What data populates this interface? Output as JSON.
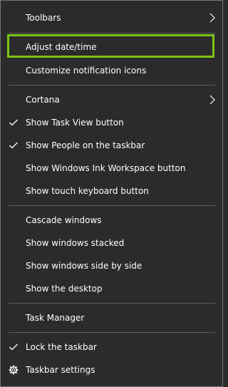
{
  "menu": {
    "items": [
      {
        "label": "Toolbars",
        "checked": false,
        "submenu": true
      },
      {
        "label": "Adjust date/time",
        "checked": false,
        "submenu": false,
        "highlighted": true
      },
      {
        "label": "Customize notification icons",
        "checked": false,
        "submenu": false
      },
      {
        "label": "Cortana",
        "checked": false,
        "submenu": true
      },
      {
        "label": "Show Task View button",
        "checked": true,
        "submenu": false
      },
      {
        "label": "Show People on the taskbar",
        "checked": true,
        "submenu": false
      },
      {
        "label": "Show Windows Ink Workspace button",
        "checked": false,
        "submenu": false
      },
      {
        "label": "Show touch keyboard button",
        "checked": false,
        "submenu": false
      },
      {
        "label": "Cascade windows",
        "checked": false,
        "submenu": false
      },
      {
        "label": "Show windows stacked",
        "checked": false,
        "submenu": false
      },
      {
        "label": "Show windows side by side",
        "checked": false,
        "submenu": false
      },
      {
        "label": "Show the desktop",
        "checked": false,
        "submenu": false
      },
      {
        "label": "Task Manager",
        "checked": false,
        "submenu": false
      },
      {
        "label": "Lock the taskbar",
        "checked": true,
        "submenu": false
      },
      {
        "label": "Taskbar settings",
        "checked": false,
        "submenu": false,
        "icon": "gear-icon"
      }
    ]
  },
  "colors": {
    "background": "#2b2b2b",
    "text": "#ffffff",
    "separator": "#5c5c5c",
    "highlight_border": "#7cc418"
  }
}
